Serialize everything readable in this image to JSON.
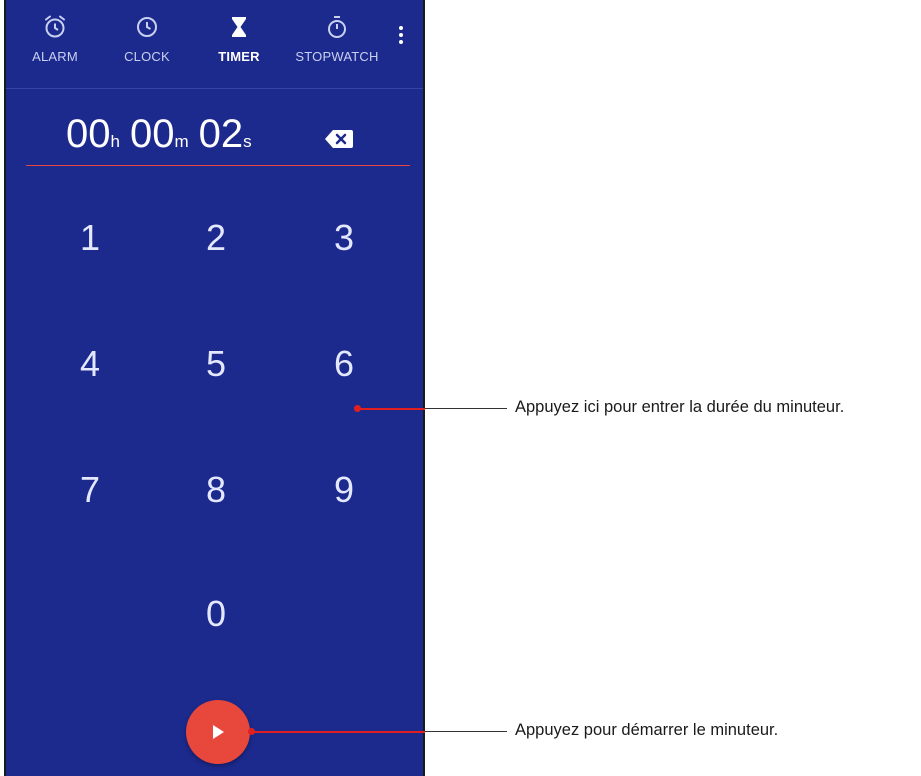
{
  "tabs": [
    {
      "label": "ALARM",
      "icon": "alarm-icon",
      "active": false
    },
    {
      "label": "CLOCK",
      "icon": "clock-icon",
      "active": false
    },
    {
      "label": "TIMER",
      "icon": "hourglass-icon",
      "active": true
    },
    {
      "label": "STOPWATCH",
      "icon": "stopwatch-icon",
      "active": false
    }
  ],
  "timer": {
    "hours": "00",
    "hours_unit": "h",
    "minutes": "00",
    "minutes_unit": "m",
    "seconds": "02",
    "seconds_unit": "s"
  },
  "keypad": [
    "1",
    "2",
    "3",
    "4",
    "5",
    "6",
    "7",
    "8",
    "9",
    "0"
  ],
  "annotations": {
    "keypad_hint": "Appuyez ici pour entrer la durée du minuteur.",
    "start_hint": "Appuyez pour démarrer le minuteur."
  },
  "colors": {
    "background": "#1c2a8e",
    "accent": "#e8473c",
    "annotation_line": "#e02020"
  }
}
